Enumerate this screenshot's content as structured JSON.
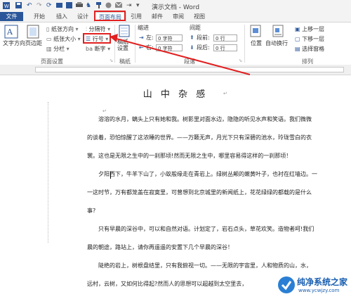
{
  "titlebar": {
    "title": "演示文档 - Word",
    "quick_access": [
      "save-icon",
      "undo-icon",
      "redo-icon",
      "refresh-icon",
      "open-icon",
      "save-as-icon",
      "print-icon",
      "find-icon",
      "format-painter-icon",
      "email-icon",
      "arrow-icon"
    ]
  },
  "tabs": [
    "文件",
    "开始",
    "插入",
    "设计",
    "页面布局",
    "引用",
    "邮件",
    "审阅",
    "视图"
  ],
  "active_tab": "页面布局",
  "ribbon": {
    "page_setup": {
      "text_direction": "文字方向",
      "margins": "页边距",
      "orientation": "纸张方向",
      "size": "纸张大小",
      "columns": "分栏",
      "breaks": "分隔符",
      "line_numbers": "行号",
      "hyphenation": "断字",
      "group_label": "页面设置"
    },
    "draft": {
      "button": "稿纸\n设置",
      "group_label": "稿纸"
    },
    "paragraph": {
      "indent_label": "缩进",
      "spacing_label": "间距",
      "left_label": "左:",
      "left_value": "0 字符",
      "right_label": "右:",
      "right_value": "0 字符",
      "before_label": "段前:",
      "before_value": "0 行",
      "after_label": "段后:",
      "after_value": "0 行",
      "group_label": "段落"
    },
    "arrange": {
      "position": "位置",
      "wrap": "自动换行",
      "bring_forward": "上移一层",
      "send_backward": "下移一层",
      "selection_pane": "选择窗格",
      "group_label": "排列"
    }
  },
  "document": {
    "title": "山 中 杂 感",
    "paragraphs": [
      "溶溶的水月，螭头上只有她和我。树影里对面水边，隐隐的听见水声和笑语。我们微微",
      "的谈着，恐怕惊醒了这浓睡的世界。——万籁无声，月光下只有深碧的池水，玲珑雪白的衣",
      "裳。这也是无限之生中的一刹那顷!然而无限之生中，哪里容易得这样的一刹那顷！",
      "夕阳西下，牛羊下山了，小蚁般缘走在青岩上。绿树丛颠的嫩黄叶子，也衬在红墙边。一",
      "一这时节，万有都笼盖在寂寞里，可曾想到北京城里的新闻纸上，花花绿绿的都载的是什么",
      "事?",
      "只有早晨的深谷中，可以和自然对语。计划定了，岩石点头，草花欢笑。造物者呵!我们",
      "晨的朝途，路站上，请你再遥遥的安置下几个早晨的深谷！",
      "陡绝的岩上，树根盘结里，只有我俯视一切。——无限的宇宙里，人和物质的山，水，",
      "远村，云树，又如何比得起?然而人的思想可以超越到太空里去，"
    ]
  },
  "watermark": {
    "name": "纯净系统之家",
    "url": "www.ycwjzy.com"
  },
  "colors": {
    "accent": "#2b579a",
    "annotation": "#e12020"
  }
}
